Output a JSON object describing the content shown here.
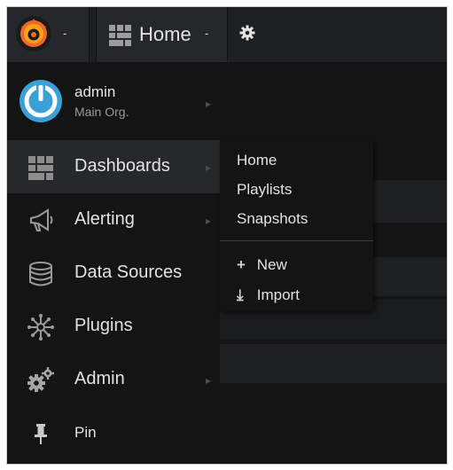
{
  "navbar": {
    "home_label": "Home",
    "caret": "-",
    "logo_icon": "grafana-logo-icon",
    "settings_icon": "gear-icon"
  },
  "profile": {
    "name": "admin",
    "org": "Main Org."
  },
  "menu": {
    "items": [
      {
        "label": "Dashboards",
        "icon": "dashboards-grid-icon",
        "active": true,
        "has_submenu": true
      },
      {
        "label": "Alerting",
        "icon": "megaphone-icon",
        "active": false,
        "has_submenu": true
      },
      {
        "label": "Data Sources",
        "icon": "database-icon",
        "active": false,
        "has_submenu": false
      },
      {
        "label": "Plugins",
        "icon": "plugins-icon",
        "active": false,
        "has_submenu": false
      },
      {
        "label": "Admin",
        "icon": "cogs-icon",
        "active": false,
        "has_submenu": true
      },
      {
        "label": "Pin",
        "icon": "pin-icon",
        "active": false,
        "has_submenu": false
      }
    ]
  },
  "submenu": {
    "items": [
      "Home",
      "Playlists",
      "Snapshots"
    ],
    "actions": [
      {
        "icon": "plus-icon",
        "glyph": "+",
        "label": "New"
      },
      {
        "icon": "import-icon",
        "glyph": "⤓",
        "label": "Import"
      }
    ]
  },
  "colors": {
    "background": "#151516",
    "sidemenu": "#141414",
    "active_item": "#27282a",
    "text": "#e3e3e3",
    "accent_blue": "#3aa0d8",
    "logo_orange": "#f0682a"
  }
}
